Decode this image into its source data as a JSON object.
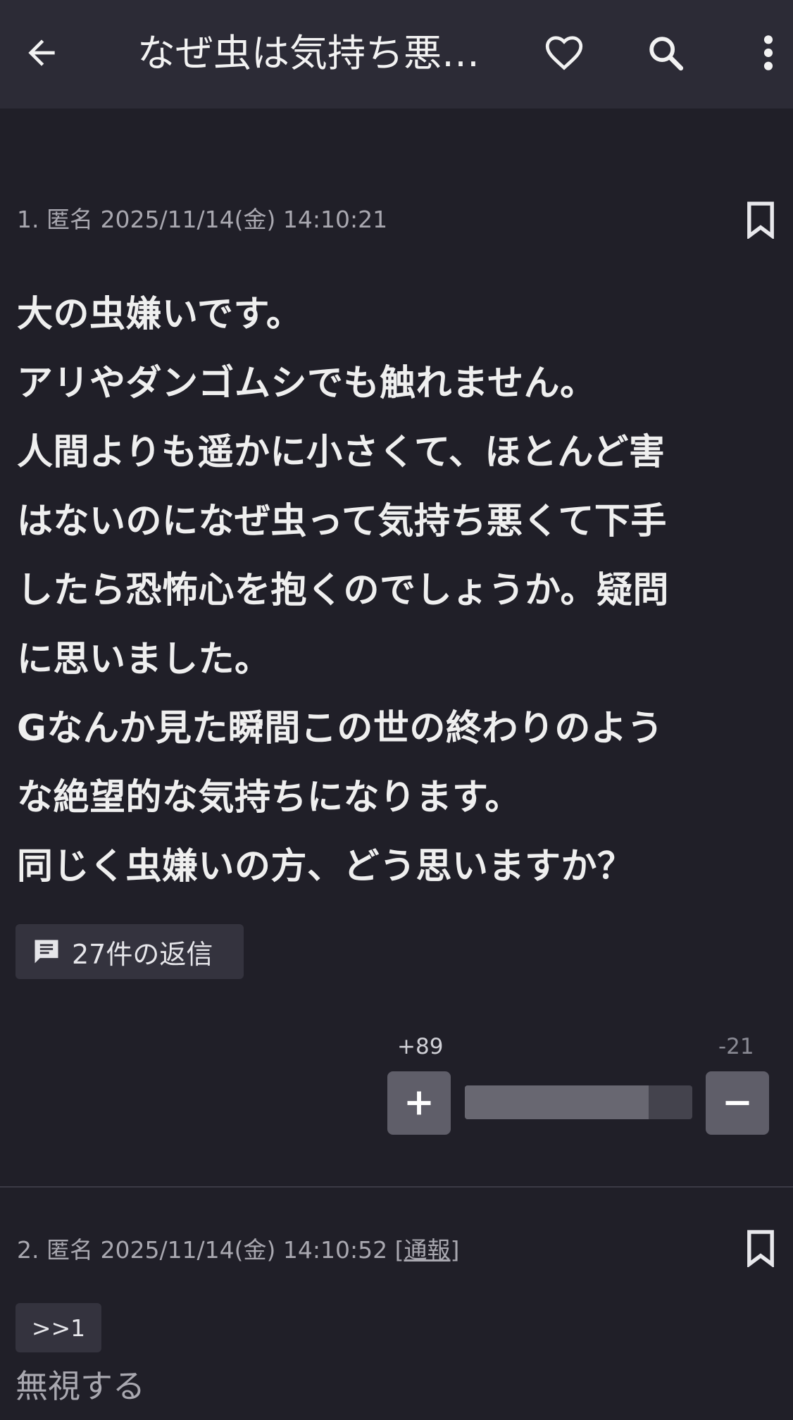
{
  "appbar": {
    "title": "なぜ虫は気持ち悪…",
    "icons": [
      "back-arrow-icon",
      "heart-icon",
      "search-icon",
      "more-vertical-icon"
    ]
  },
  "post1": {
    "meta": "1. 匿名 2025/11/14(金) 14:10:21",
    "body_lines": [
      "大の虫嫌いです。",
      "アリやダンゴムシでも触れません。",
      "人間よりも遥かに小さくて、ほとんど害",
      "はないのになぜ虫って気持ち悪くて下手",
      "したら恐怖心を抱くのでしょうか。疑問",
      "に思いました。",
      "Gなんか見た瞬間この世の終わりのよう",
      "な絶望的な気持ちになります。",
      "同じく虫嫌いの方、どう思いますか？"
    ],
    "replies_label": "27件の返信",
    "votes": {
      "plus": "+89",
      "minus": "-21",
      "plus_fraction": 0.809
    }
  },
  "post2": {
    "meta_prefix": "2. 匿名 2025/11/14(金) 14:10:52 ",
    "report_label": "[通報]",
    "anchor": ">>1",
    "ignore_label": "無視する"
  },
  "colors": {
    "background": "#201f28",
    "appbar": "#2c2b36",
    "chip": "#34333e",
    "vote_button": "#5f5e69"
  }
}
